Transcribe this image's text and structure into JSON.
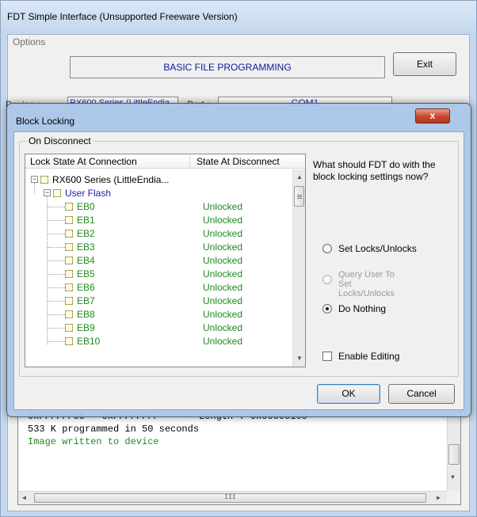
{
  "window": {
    "title": "FDT Simple Interface   (Unsupported Freeware Version)",
    "menu": [
      "Options"
    ],
    "banner": "BASIC FILE PROGRAMMING",
    "exit_label": "Exit",
    "device_label": "Device :",
    "device_value": "RX600 Series (LittleEndia",
    "port_label": "Port :",
    "port_value": "COM1"
  },
  "log": {
    "lines": [
      {
        "text": "0xFFFFFF00 - 0xFFFFFFFF       Length : 0x00000100",
        "color": "#000000"
      },
      {
        "text": "533 K programmed in 50 seconds",
        "color": "#000000"
      },
      {
        "text": "Image written to device",
        "color": "#1f8a1f"
      }
    ],
    "hscroll_thumb": "III"
  },
  "dialog": {
    "title": "Block Locking",
    "close_label": "x",
    "group_label": "On Disconnect",
    "columns": [
      "Lock State At Connection",
      "State At Disconnect"
    ],
    "root_node": "RX600 Series (LittleEndia...",
    "area_node": "User Flash",
    "blocks": [
      {
        "name": "EB0",
        "state": "Unlocked"
      },
      {
        "name": "EB1",
        "state": "Unlocked"
      },
      {
        "name": "EB2",
        "state": "Unlocked"
      },
      {
        "name": "EB3",
        "state": "Unlocked"
      },
      {
        "name": "EB4",
        "state": "Unlocked"
      },
      {
        "name": "EB5",
        "state": "Unlocked"
      },
      {
        "name": "EB6",
        "state": "Unlocked"
      },
      {
        "name": "EB7",
        "state": "Unlocked"
      },
      {
        "name": "EB8",
        "state": "Unlocked"
      },
      {
        "name": "EB9",
        "state": "Unlocked"
      },
      {
        "name": "EB10",
        "state": "Unlocked"
      }
    ],
    "question": "What should FDT do with the block locking settings now?",
    "options": [
      {
        "label": "Set Locks/Unlocks",
        "selected": false,
        "enabled": true
      },
      {
        "label": "Query User To Set Locks/Unlocks",
        "selected": false,
        "enabled": false
      },
      {
        "label": "Do Nothing",
        "selected": true,
        "enabled": true
      }
    ],
    "enable_editing_label": "Enable Editing",
    "enable_editing_checked": false,
    "ok_label": "OK",
    "cancel_label": "Cancel"
  },
  "colors": {
    "unlocked": "#1f8a1f",
    "area_node": "#1a1aa8",
    "banner_text": "#0a1a9c",
    "close_button": "#c6462b"
  }
}
